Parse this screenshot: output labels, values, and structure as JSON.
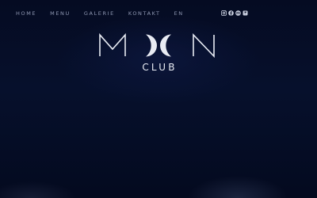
{
  "nav": {
    "items": [
      {
        "label": "HOME"
      },
      {
        "label": "MENU"
      },
      {
        "label": "GALERIE"
      },
      {
        "label": "KONTAKT"
      },
      {
        "label": "EN"
      }
    ]
  },
  "social": [
    {
      "icon": "instagram-icon"
    },
    {
      "icon": "facebook-icon"
    },
    {
      "icon": "tripadvisor-icon"
    },
    {
      "icon": "foursquare-icon"
    }
  ],
  "logo": {
    "title": "MOON",
    "subtitle": "CLUB"
  },
  "colors": {
    "background": "#050c24",
    "nav_text": "#8f98b3",
    "logo": "#e8ebf3"
  }
}
